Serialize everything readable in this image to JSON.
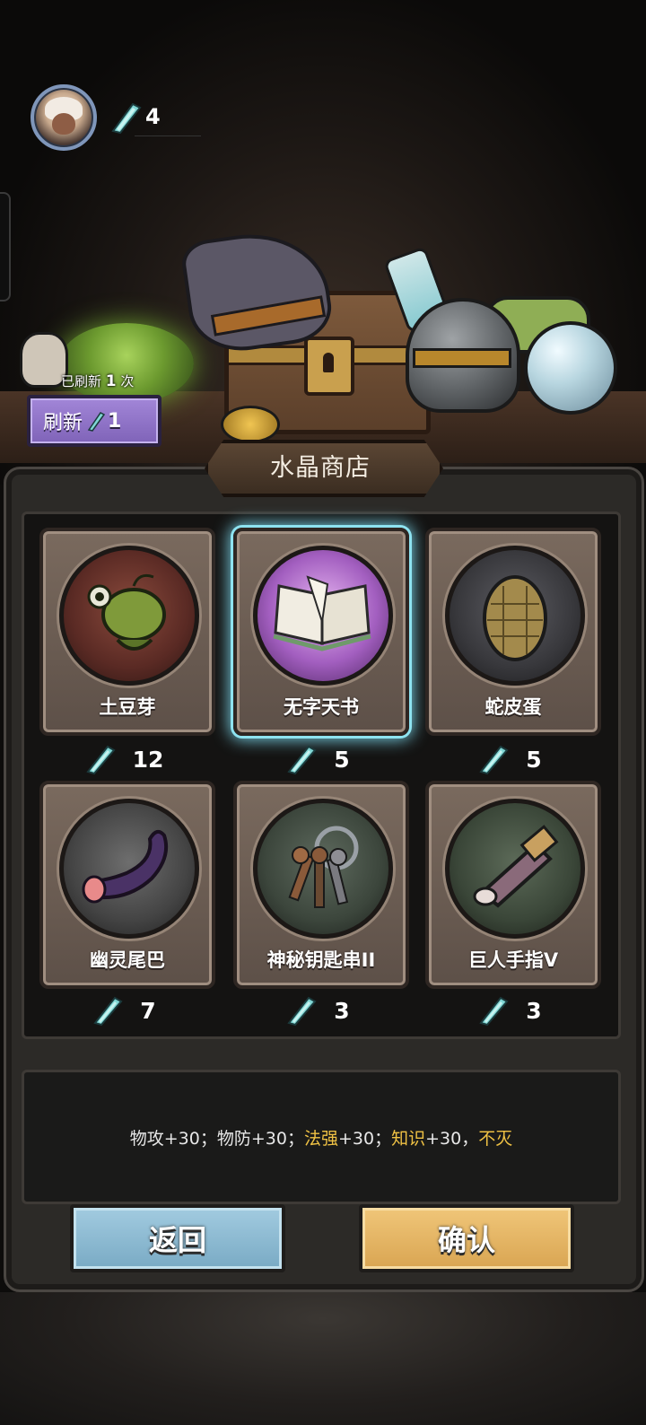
{
  "header": {
    "crystal_count": "4",
    "icons": {
      "avatar": "player-avatar",
      "currency": "crystal-icon"
    }
  },
  "refresh": {
    "status_prefix": "已刷新",
    "status_count": "1",
    "status_suffix": "次",
    "button_label": "刷新",
    "button_cost": "1"
  },
  "shop": {
    "title": "水晶商店",
    "items": [
      {
        "name": "土豆芽",
        "price": "12",
        "icon": "sprout-creature-icon",
        "medal_color": "#6b2f28"
      },
      {
        "name": "无字天书",
        "price": "5",
        "icon": "open-book-icon",
        "medal_color": "#9a5ab0",
        "selected": true
      },
      {
        "name": "蛇皮蛋",
        "price": "5",
        "icon": "scaled-egg-icon",
        "medal_color": "#3e3e42"
      },
      {
        "name": "幽灵尾巴",
        "price": "7",
        "icon": "ghost-tail-icon",
        "medal_color": "#464646"
      },
      {
        "name": "神秘钥匙串II",
        "price": "3",
        "icon": "key-ring-icon",
        "medal_color": "#3f4a3f"
      },
      {
        "name": "巨人手指V",
        "price": "3",
        "icon": "giant-finger-icon",
        "medal_color": "#3c4a3a"
      }
    ]
  },
  "description": {
    "parts": [
      {
        "text": "物攻+30；物防+30；",
        "style": "normal"
      },
      {
        "text": "法强",
        "style": "gold"
      },
      {
        "text": "+30；",
        "style": "normal"
      },
      {
        "text": "知识",
        "style": "gold"
      },
      {
        "text": "+30，",
        "style": "normal"
      },
      {
        "text": "不灭",
        "style": "gold"
      }
    ]
  },
  "buttons": {
    "back": "返回",
    "confirm": "确认"
  },
  "colors": {
    "accent_gold": "#f0c244",
    "selected_glow": "#7ad4e8",
    "refresh_purple": "#8c70c8"
  }
}
